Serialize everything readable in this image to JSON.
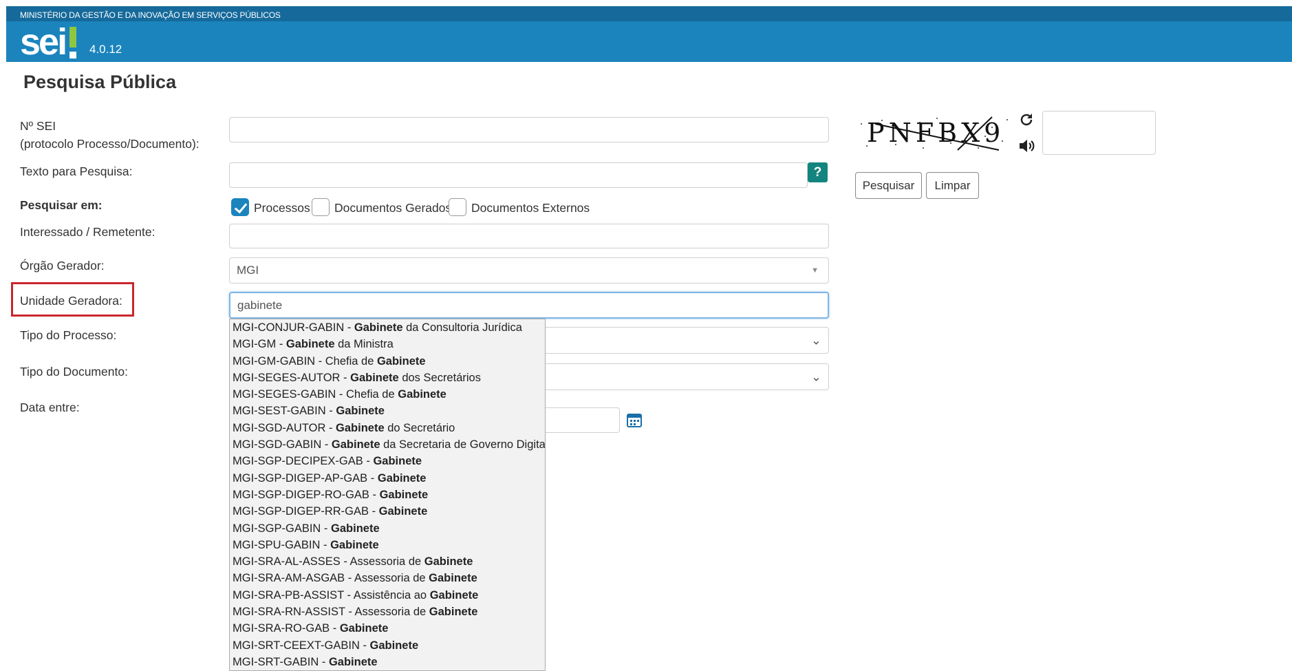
{
  "header": {
    "ministry": "MINISTÉRIO DA GESTÃO E DA INOVAÇÃO EM SERVIÇOS PÚBLICOS",
    "logo_text": "sei",
    "version": "4.0.12",
    "colors": {
      "bar": "#1b84bd",
      "strip": "#156a9b",
      "logo_accent": "#8ec63f"
    }
  },
  "page_title": "Pesquisa Pública",
  "form": {
    "nsei_label_1": "Nº SEI",
    "nsei_label_2": "(protocolo Processo/Documento):",
    "nsei_value": "",
    "texto_label": "Texto para Pesquisa:",
    "texto_value": "",
    "help_label": "?",
    "pesquisar_em_label": "Pesquisar em:",
    "options": [
      {
        "label": "Processos",
        "checked": true
      },
      {
        "label": "Documentos Gerados",
        "checked": false
      },
      {
        "label": "Documentos Externos",
        "checked": false
      }
    ],
    "interessado_label": "Interessado / Remetente:",
    "interessado_value": "",
    "orgao_label": "Órgão Gerador:",
    "orgao_value": "MGI",
    "unidade_label": "Unidade Geradora:",
    "unidade_value": "gabinete",
    "tipo_processo_label": "Tipo do Processo:",
    "tipo_documento_label": "Tipo do Documento:",
    "data_label": "Data entre:"
  },
  "autocomplete": [
    [
      "MGI-CONJUR-GABIN - ",
      "Gabinete",
      " da Consultoria Jurídica"
    ],
    [
      "MGI-GM - ",
      "Gabinete",
      " da Ministra"
    ],
    [
      "MGI-GM-GABIN - Chefia de ",
      "Gabinete",
      ""
    ],
    [
      "MGI-SEGES-AUTOR - ",
      "Gabinete",
      " dos Secretários"
    ],
    [
      "MGI-SEGES-GABIN - Chefia de ",
      "Gabinete",
      ""
    ],
    [
      "MGI-SEST-GABIN - ",
      "Gabinete",
      ""
    ],
    [
      "MGI-SGD-AUTOR - ",
      "Gabinete",
      " do Secretário"
    ],
    [
      "MGI-SGD-GABIN - ",
      "Gabinete",
      " da Secretaria de Governo Digital"
    ],
    [
      "MGI-SGP-DECIPEX-GAB - ",
      "Gabinete",
      ""
    ],
    [
      "MGI-SGP-DIGEP-AP-GAB - ",
      "Gabinete",
      ""
    ],
    [
      "MGI-SGP-DIGEP-RO-GAB - ",
      "Gabinete",
      ""
    ],
    [
      "MGI-SGP-DIGEP-RR-GAB - ",
      "Gabinete",
      ""
    ],
    [
      "MGI-SGP-GABIN - ",
      "Gabinete",
      ""
    ],
    [
      "MGI-SPU-GABIN - ",
      "Gabinete",
      ""
    ],
    [
      "MGI-SRA-AL-ASSES - Assessoria de ",
      "Gabinete",
      ""
    ],
    [
      "MGI-SRA-AM-ASGAB - Assessoria de ",
      "Gabinete",
      ""
    ],
    [
      "MGI-SRA-PB-ASSIST - Assistência ao ",
      "Gabinete",
      ""
    ],
    [
      "MGI-SRA-RN-ASSIST - Assessoria de ",
      "Gabinete",
      ""
    ],
    [
      "MGI-SRA-RO-GAB - ",
      "Gabinete",
      ""
    ],
    [
      "MGI-SRT-CEEXT-GABIN - ",
      "Gabinete",
      ""
    ],
    [
      "MGI-SRT-GABIN - ",
      "Gabinete",
      ""
    ]
  ],
  "captcha": {
    "text": "PNFBX9",
    "answer": ""
  },
  "buttons": {
    "pesquisar": "Pesquisar",
    "limpar": "Limpar"
  },
  "icons": {
    "help": "help-icon",
    "refresh": "refresh-icon",
    "audio": "speaker-icon",
    "calendar": "calendar-icon",
    "chevron": "chevron-down-icon"
  }
}
